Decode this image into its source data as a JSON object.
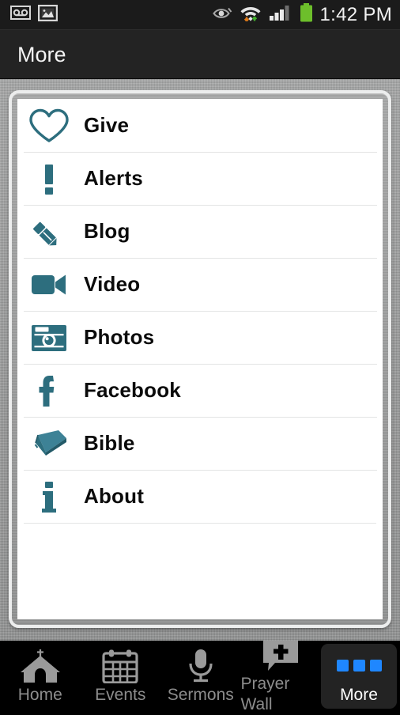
{
  "statusbar": {
    "time": "1:42 PM",
    "left_icons": [
      {
        "name": "voicemail-icon"
      },
      {
        "name": "photo-icon"
      }
    ],
    "right_icons": [
      {
        "name": "eye-icon"
      },
      {
        "name": "wifi-icon"
      },
      {
        "name": "signal-icon"
      },
      {
        "name": "battery-icon"
      }
    ]
  },
  "actionbar": {
    "title": "More"
  },
  "colors": {
    "icon_teal": "#2d6e7e",
    "accent_blue": "#1f87ff",
    "label_black": "#0b0b0b",
    "background_gray": "#9a9b9b",
    "tab_inactive": "#8d8d8d"
  },
  "list": {
    "items": [
      {
        "label": "Give",
        "icon": "heart-icon"
      },
      {
        "label": "Alerts",
        "icon": "exclamation-icon"
      },
      {
        "label": "Blog",
        "icon": "pencil-icon"
      },
      {
        "label": "Video",
        "icon": "video-camera-icon"
      },
      {
        "label": "Photos",
        "icon": "camera-icon"
      },
      {
        "label": "Facebook",
        "icon": "facebook-icon"
      },
      {
        "label": "Bible",
        "icon": "book-icon"
      },
      {
        "label": "About",
        "icon": "info-icon"
      }
    ]
  },
  "tabbar": {
    "items": [
      {
        "label": "Home",
        "icon": "church-icon",
        "active": false
      },
      {
        "label": "Events",
        "icon": "calendar-icon",
        "active": false
      },
      {
        "label": "Sermons",
        "icon": "microphone-icon",
        "active": false
      },
      {
        "label": "Prayer Wall",
        "icon": "speech-cross-icon",
        "active": false
      },
      {
        "label": "More",
        "icon": "three-dots-icon",
        "active": true
      }
    ]
  }
}
